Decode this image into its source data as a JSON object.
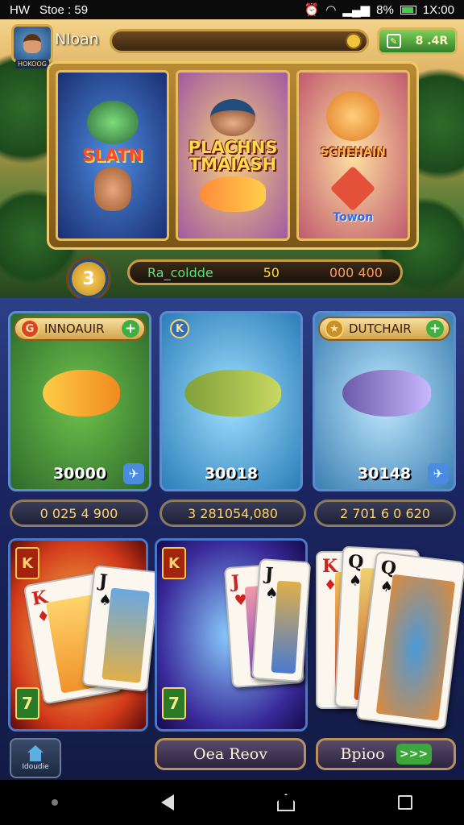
{
  "status_bar": {
    "left": "HW",
    "carrier": "Stoe : 59",
    "battery": "8%",
    "time": "1X:00"
  },
  "header": {
    "player_name": "Nloan",
    "avatar_label": "HOKOOG",
    "wallet_label": "8 .4R"
  },
  "hero": {
    "panels": [
      {
        "title": "SLATN",
        "subtitle": ""
      },
      {
        "title": "PLACHNS TMAIASH",
        "subtitle": ""
      },
      {
        "title": "SCHEHAIN",
        "subtitle": "Towon"
      }
    ]
  },
  "level": "3",
  "record": {
    "label": "Ra_coldde",
    "mid": "50",
    "value": "000 400"
  },
  "games": [
    {
      "badge": "G",
      "name": "INNOAUIR",
      "score": "30000",
      "icon": "✈"
    },
    {
      "badge": "K",
      "name": "",
      "score": "30018",
      "icon": "✈"
    },
    {
      "badge": "★",
      "name": "DUTCHAIR",
      "score": "30148",
      "icon": "✈"
    }
  ],
  "pills": [
    "0 025 4 900",
    "3 281054,080",
    "2 701 6 0 620"
  ],
  "card_zones": [
    {
      "badge_top": "K",
      "badge_bottom": "7"
    },
    {
      "badge_top": "K",
      "badge_bottom": "7"
    }
  ],
  "buttons": {
    "home_label": "Idoudie",
    "primary": "Oea Reov",
    "secondary": "Bpioo",
    "secondary_chip": ">>>"
  },
  "colors": {
    "accent_gold": "#d6a94a",
    "panel_blue": "#2d3f86",
    "button_green": "#3aa83a"
  }
}
